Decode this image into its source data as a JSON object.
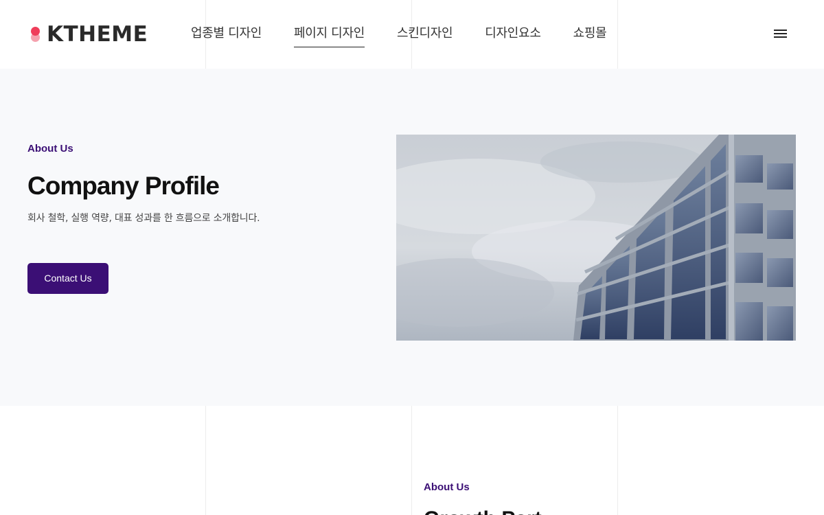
{
  "brand": {
    "name": "KTHEME",
    "mark_colors": [
      "#ef3d5a",
      "#f5a1ae"
    ]
  },
  "nav": {
    "items": [
      {
        "label": "업종별 디자인",
        "active": false
      },
      {
        "label": "페이지 디자인",
        "active": true
      },
      {
        "label": "스킨디자인",
        "active": false
      },
      {
        "label": "디자인요소",
        "active": false
      },
      {
        "label": "쇼핑몰",
        "active": false
      }
    ],
    "menu_icon": "hamburger-menu-icon"
  },
  "hero": {
    "eyebrow": "About Us",
    "title": "Company Profile",
    "description": "회사 철학, 실행 역량, 대표 성과를 한 흐름으로 소개합니다.",
    "button_label": "Contact Us",
    "image_subject": "office-building-photo"
  },
  "section2": {
    "eyebrow": "About Us",
    "title": "Growth Part"
  },
  "colors": {
    "accent": "#3b0f75",
    "hero_bg": "#f8f9fb"
  }
}
